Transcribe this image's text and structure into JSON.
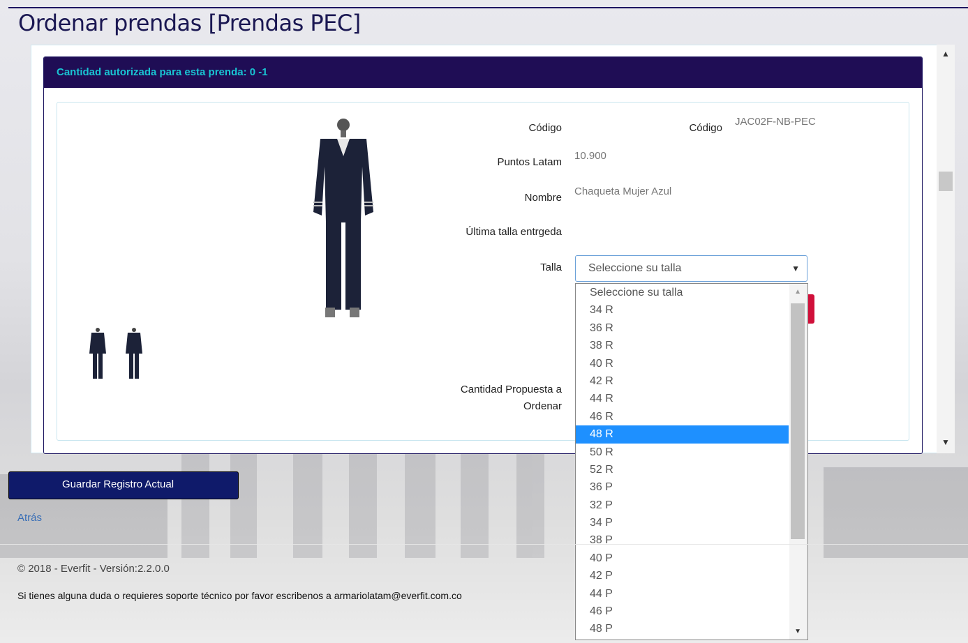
{
  "page": {
    "title": "Ordenar prendas [Prendas PEC]"
  },
  "card": {
    "header": "Cantidad autorizada para esta prenda: 0 -1"
  },
  "product": {
    "codigo_label": "Código",
    "codigo_label_2": "Código",
    "codigo_value": "JAC02F-NB-PEC",
    "puntos_label": "Puntos Latam",
    "puntos_value": "10.900",
    "nombre_label": "Nombre",
    "nombre_value": "Chaqueta Mujer Azul",
    "ultima_label": "Última talla entrgeda",
    "talla_label": "Talla",
    "cantidad_label_1": "Cantidad Propuesta a",
    "cantidad_label_2": "Ordenar"
  },
  "talla_select": {
    "placeholder": "Seleccione su talla",
    "options": [
      "Seleccione su talla",
      "34 R",
      "36 R",
      "38 R",
      "40 R",
      "42 R",
      "44 R",
      "46 R",
      "48 R",
      "50 R",
      "52 R",
      "36 P",
      "32 P",
      "34 P",
      "38 P",
      "40 P",
      "42 P",
      "44 P",
      "46 P",
      "48 P"
    ],
    "highlighted": "48 R"
  },
  "actions": {
    "save_label": "Guardar Registro Actual",
    "back_label": "Atrás"
  },
  "footer": {
    "copyright": "© 2018 - Everfit - Versión:2.2.0.0",
    "support": "Si tienes alguna duda o requieres soporte técnico por favor escribenos a armariolatam@everfit.com.co"
  },
  "colors": {
    "header_bg": "#1f0d55",
    "header_text": "#19c4d2",
    "accent": "#1e90ff",
    "button_bg": "#0f1a6a",
    "danger": "#d0103a"
  }
}
